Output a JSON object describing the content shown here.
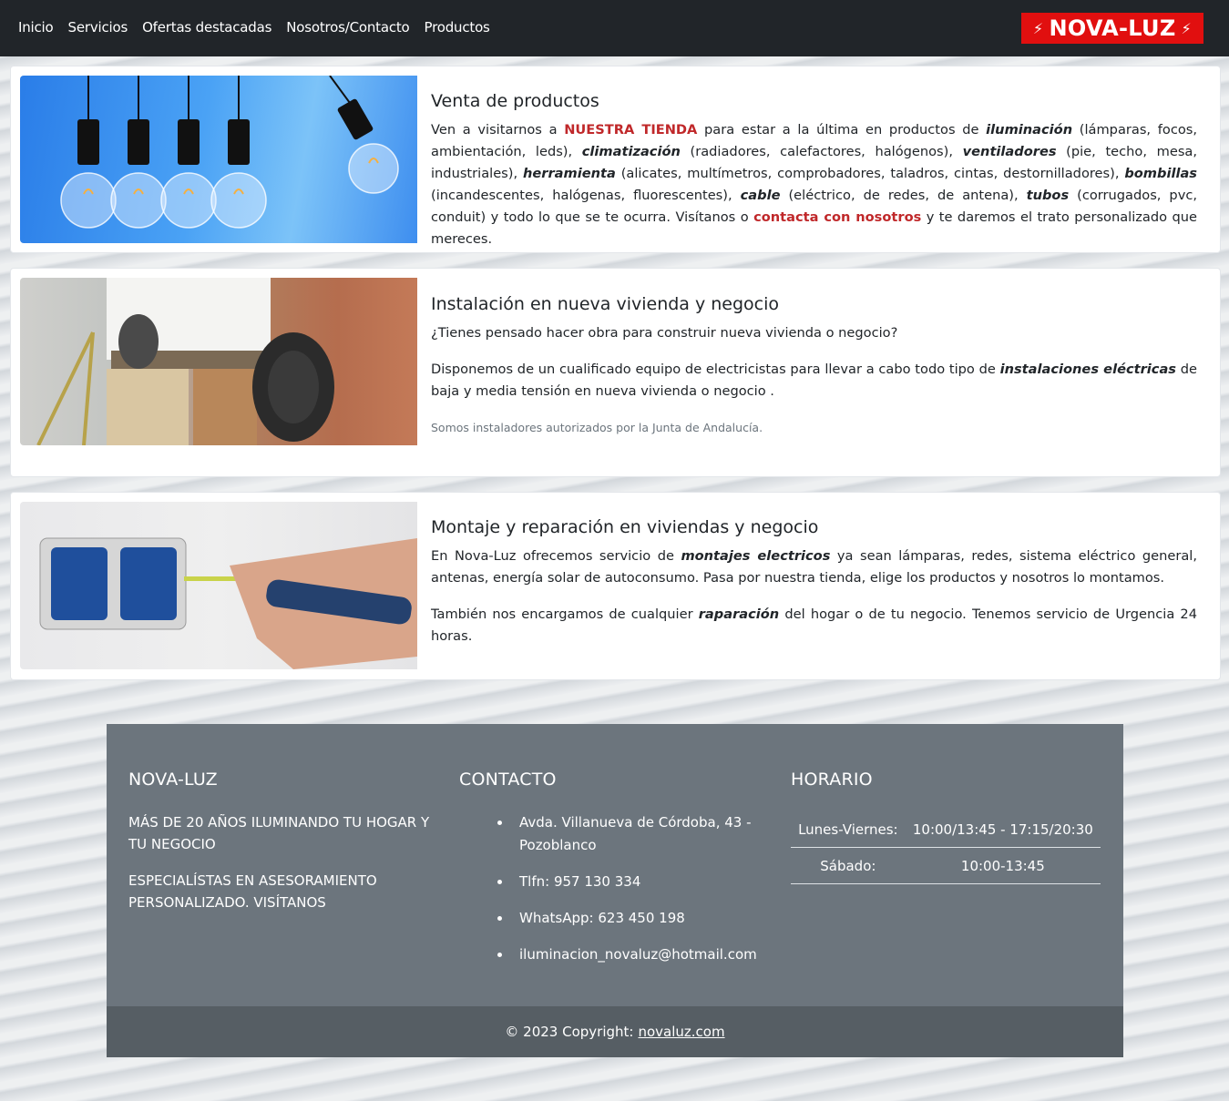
{
  "nav": {
    "links": [
      "Inicio",
      "Servicios",
      "Ofertas destacadas",
      "Nosotros/Contacto",
      "Productos"
    ],
    "logo_text": "NOVA-LUZ",
    "logo_bolt": "ϟ"
  },
  "cards": [
    {
      "title": "Venta de productos",
      "image": "light-bulbs-photo",
      "p1": {
        "t1": "Ven a visitarnos a ",
        "link1": "NUESTRA TIENDA",
        "t2": " para estar a la última en productos de ",
        "b1": "iluminación",
        "t3": " (lámparas, focos, ambientación, leds), ",
        "b2": "climatización",
        "t4": " (radiadores, calefactores, halógenos), ",
        "b3": "ventiladores",
        "t5": " (pie, techo, mesa, industriales), ",
        "b4": "herramienta",
        "t6": " (alicates, multímetros, comprobadores, taladros, cintas, destornilladores), ",
        "b5": "bombillas",
        "t7": " (incandescentes, halógenas, fluorescentes), ",
        "b6": "cable",
        "t8": " (eléctrico, de redes, de antena), ",
        "b7": "tubos",
        "t9": " (corrugados, pvc, conduit) y todo lo que se te ocurra. Visítanos o ",
        "link2": "contacta con nosotros",
        "t10": " y te daremos el trato personalizado que mereces."
      }
    },
    {
      "title": "Instalación en nueva vivienda y negocio",
      "image": "electrician-photo",
      "p1": "¿Tienes pensado hacer obra para construir nueva vivienda o negocio?",
      "p2": {
        "t1": "Disponemos de un cualificado equipo de electricistas para llevar a cabo todo tipo de ",
        "b1": "instalaciones eléctricas",
        "t2": " de baja y media tensión en nueva vivienda o negocio ."
      },
      "note": "Somos instaladores autorizados por la Junta de Andalucía."
    },
    {
      "title": "Montaje y reparación en viviendas y negocio",
      "image": "socket-repair-photo",
      "p1": {
        "t1": "En Nova-Luz ofrecemos servicio de ",
        "b1": "montajes electricos",
        "t2": " ya sean lámparas, redes, sistema eléctrico general, antenas, energía solar de autoconsumo. Pasa por nuestra tienda, elige los productos y nosotros lo montamos."
      },
      "p2": {
        "t1": "También nos encargamos de cualquier ",
        "b1": "raparación",
        "t2": " del hogar o de tu negocio. Tenemos servicio de Urgencia 24 horas."
      }
    }
  ],
  "footer": {
    "brand": {
      "title": "NOVA-LUZ",
      "line1": "MÁS DE 20 AÑOS ILUMINANDO TU HOGAR Y TU NEGOCIO",
      "line2": "ESPECIALÍSTAS EN ASESORAMIENTO PERSONALIZADO. VISÍTANOS"
    },
    "contact": {
      "title": "CONTACTO",
      "items": [
        "Avda. Villanueva de Córdoba, 43 - Pozoblanco",
        "Tlfn: 957 130 334",
        "WhatsApp: 623 450 198",
        "iluminacion_novaluz@hotmail.com"
      ]
    },
    "hours": {
      "title": "HORARIO",
      "rows": [
        {
          "day": "Lunes-Viernes:",
          "time": "10:00/13:45 - 17:15/20:30"
        },
        {
          "day": "Sábado:",
          "time": "10:00-13:45"
        }
      ]
    },
    "copyright": {
      "text": "© 2023 Copyright:",
      "link": "novaluz.com"
    }
  },
  "colors": {
    "navbar_bg": "#212529",
    "logo_bg": "#e10f0f",
    "accent_red": "#c0282a",
    "footer_bg": "#6c757d",
    "copyright_bg": "#565e64"
  }
}
